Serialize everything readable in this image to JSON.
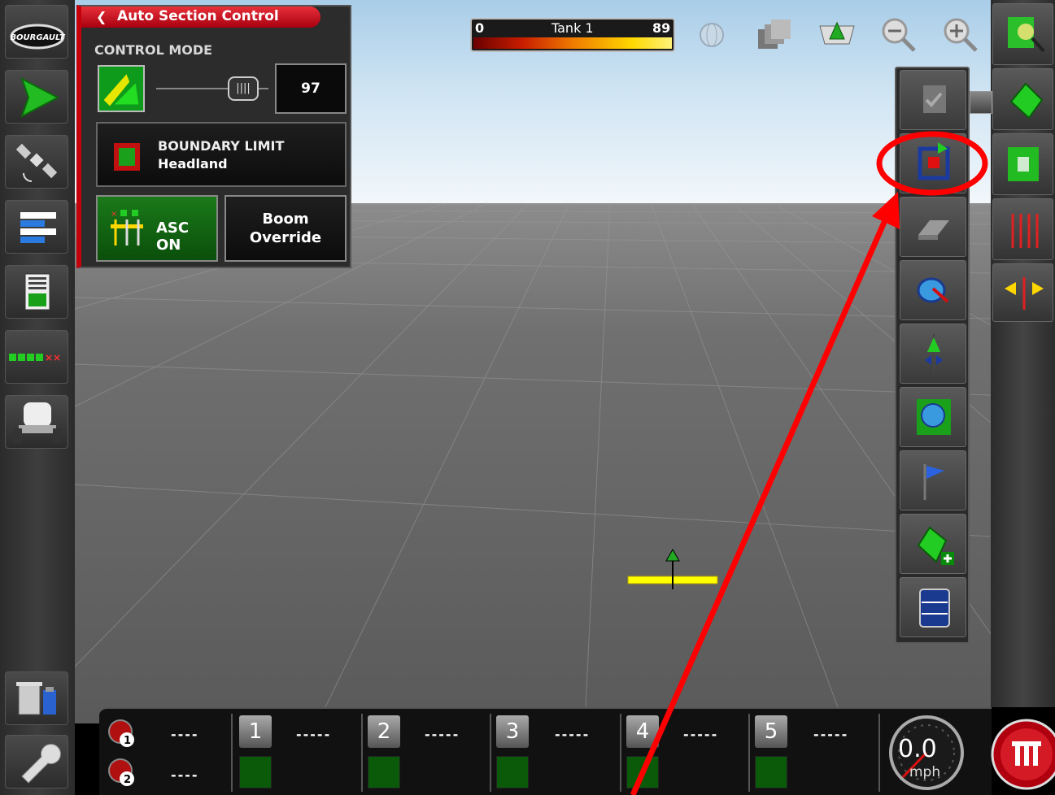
{
  "asc_panel": {
    "title": "Auto Section Control",
    "control_mode_label": "CONTROL MODE",
    "slider_value": "97",
    "boundary_limit_title": "BOUNDARY LIMIT",
    "boundary_limit_value": "Headland",
    "asc_on_label": "ASC ON",
    "boom_override_label": "Boom Override"
  },
  "tank": {
    "label": "Tank 1",
    "min": "0",
    "max": "89"
  },
  "top_icons": [
    "gps-globe-icon",
    "layers-icon",
    "view-3d-icon",
    "zoom-out-icon",
    "zoom-in-icon"
  ],
  "left_toolbar": [
    "bourgault-logo",
    "guidance-icon",
    "gnss-satellite-icon",
    "section-config-icon",
    "task-report-icon",
    "section-status-icon",
    "implement-icon",
    "delete-data-icon",
    "settings-wrench-icon"
  ],
  "right_toolbar": [
    "field-explorer-icon",
    "field-boundary-icon",
    "headland-icon",
    "guideline-icon",
    "steering-nudge-icon"
  ],
  "sub_menu": [
    "apply-confirm-icon",
    "boundary-record-icon",
    "erase-icon",
    "boundary-drive-icon",
    "guideline-marker-icon",
    "coverage-icon",
    "flag-marker-icon",
    "add-field-icon",
    "scroll-menu-icon"
  ],
  "bottom_bar": {
    "products": [
      {
        "label": "1",
        "rate": "-----"
      },
      {
        "label": "2",
        "rate": "-----"
      },
      {
        "label": "3",
        "rate": "-----"
      },
      {
        "label": "4",
        "rate": "-----"
      },
      {
        "label": "5",
        "rate": "-----"
      }
    ],
    "channel_rates": [
      "----",
      "----"
    ],
    "channel_labels": [
      "1",
      "2"
    ],
    "speed_value": "0.0",
    "speed_unit": "mph"
  },
  "colors": {
    "accent_red": "#d4000b",
    "asc_green": "#1a7a1a",
    "highlight_circle": "#ff0000"
  }
}
